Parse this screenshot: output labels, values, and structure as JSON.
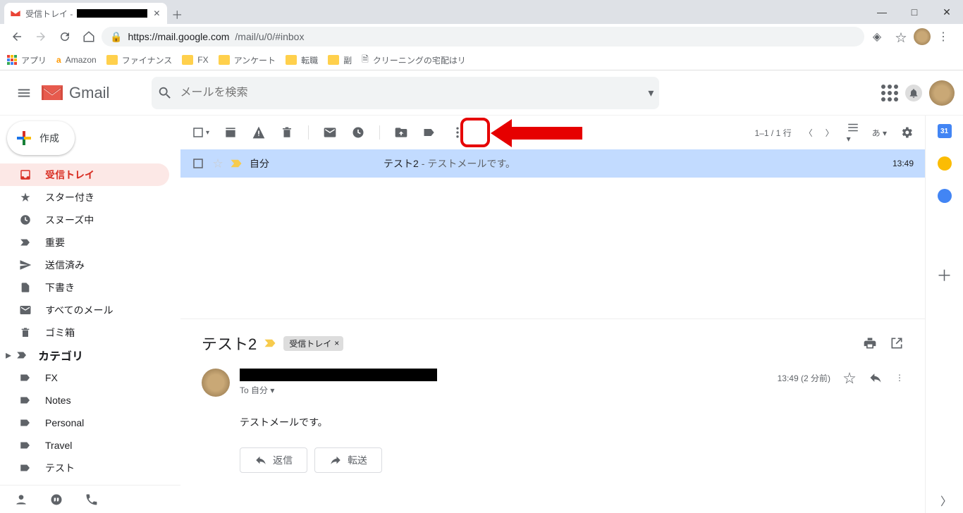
{
  "browser": {
    "tab_title_prefix": "受信トレイ -",
    "url_host": "https://mail.google.com",
    "url_path": "/mail/u/0/#inbox",
    "bookmarks": {
      "apps": "アプリ",
      "amazon": "Amazon",
      "finance": "ファイナンス",
      "fx": "FX",
      "survey": "アンケート",
      "jobs": "転職",
      "side": "副",
      "cleaning": "クリーニングの宅配はリ"
    }
  },
  "header": {
    "brand": "Gmail",
    "search_placeholder": "メールを検索"
  },
  "compose_label": "作成",
  "nav": {
    "inbox": "受信トレイ",
    "starred": "スター付き",
    "snoozed": "スヌーズ中",
    "important": "重要",
    "sent": "送信済み",
    "drafts": "下書き",
    "all": "すべてのメール",
    "trash": "ゴミ箱",
    "categories": "カテゴリ",
    "fx": "FX",
    "notes": "Notes",
    "personal": "Personal",
    "travel": "Travel",
    "test": "テスト"
  },
  "toolbar": {
    "pager": "1–1 / 1 行",
    "input_tool": "あ"
  },
  "email": {
    "sender": "自分",
    "subject": "テスト2",
    "sep": " - ",
    "preview": "テストメールです。",
    "time": "13:49"
  },
  "conversation": {
    "subject": "テスト2",
    "label": "受信トレイ",
    "to_prefix": "To ",
    "to": "自分",
    "timestamp": "13:49 (2 分前)",
    "body": "テストメールです。",
    "reply": "返信",
    "forward": "転送"
  },
  "sidepanel": {
    "cal_day": "31"
  }
}
